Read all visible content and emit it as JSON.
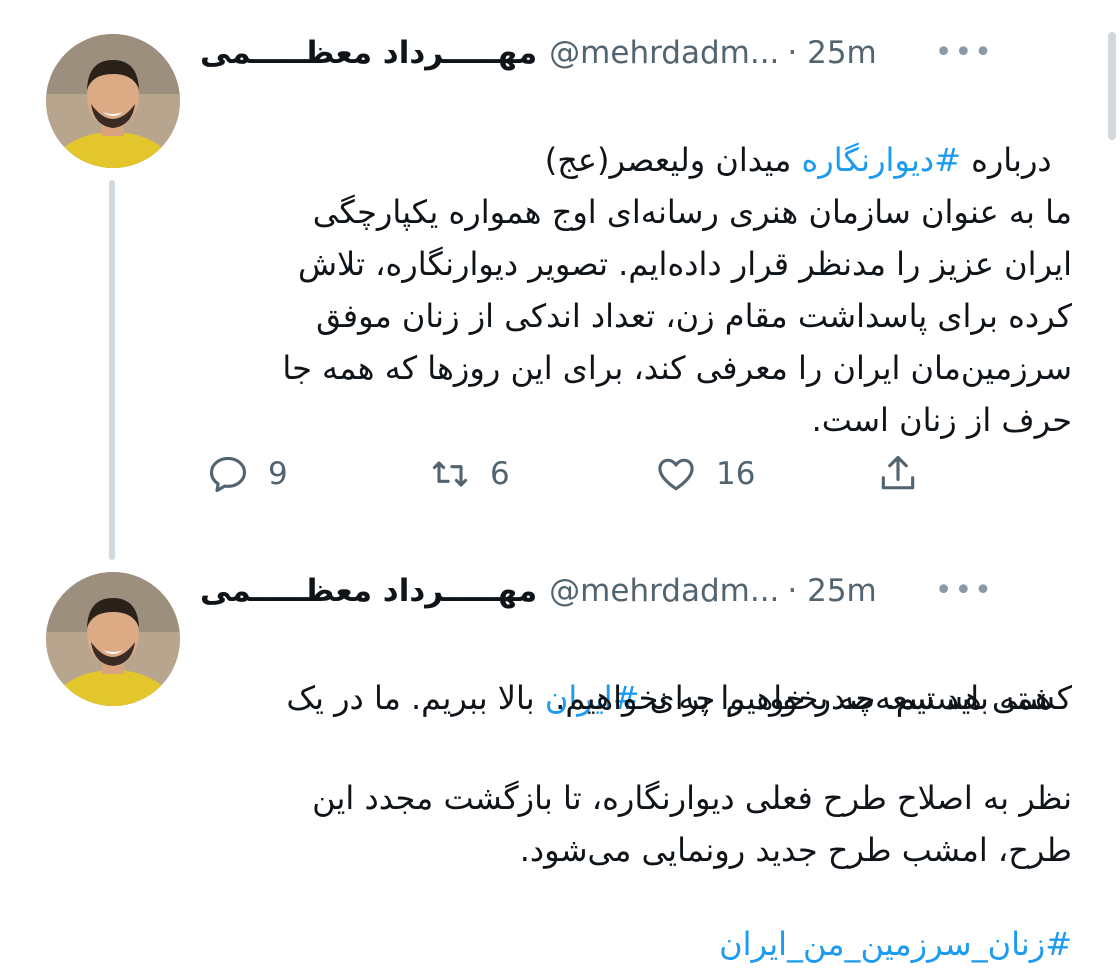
{
  "tweets": [
    {
      "display_name": "مهـــــرداد معظـــــمی",
      "handle": "@mehrdadm...",
      "time": "· 25m",
      "line1_prefix": "درباره ",
      "line1_hashtag": "#دیوارنگاره",
      "line1_suffix": " میدان ولیعصر(عج)",
      "body": "ما به عنوان سازمان هنری رسانه‌ای اوج همواره یکپارچگی\nایران عزیز را مدنظر قرار داده‌ایم. تصویر دیوارنگاره، تلاش\nکرده برای پاسداشت مقام زن، تعداد اندکی از زنان موفق\nسرزمین‌مان ایران را معرفی کند، برای این روزها که همه جا\nحرف از زنان است.",
      "actions": {
        "replies": "9",
        "retweets": "6",
        "likes": "16"
      }
    },
    {
      "display_name": "مهـــــرداد معظـــــمی",
      "handle": "@mehrdadm...",
      "time": "· 25m",
      "line1_prefix": "همه باید سعه‌صدر خود را برای ",
      "line1_hashtag": "#ایران",
      "line1_suffix": " بالا ببریم. ما در یک",
      "line2": "کشتی هستیم. چه بخواهیم چه نخواهیم.",
      "body": "نظر به اصلاح طرح فعلی دیوارنگاره، تا بازگشت مجدد این\nطرح، امشب طرح جدید رونمایی می‌شود.",
      "footer_hashtag": "#زنان_سرزمین_من_ایران"
    }
  ],
  "icons": {
    "more": "more-icon",
    "reply": "reply-icon",
    "retweet": "retweet-icon",
    "like": "heart-icon",
    "share": "share-icon"
  },
  "colors": {
    "hashtag": "#1d9bf0",
    "secondary_text": "#536471",
    "thread_line": "#cfd9de"
  }
}
